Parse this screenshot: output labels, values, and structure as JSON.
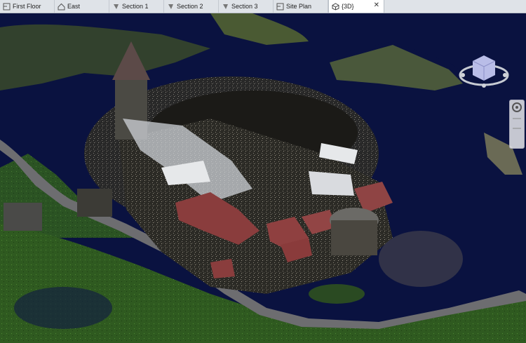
{
  "tabs": [
    {
      "label": "First Floor",
      "icon": "floor-plan-icon",
      "active": false
    },
    {
      "label": "East",
      "icon": "elevation-icon",
      "active": false
    },
    {
      "label": "Section 1",
      "icon": "section-icon",
      "active": false
    },
    {
      "label": "Section 2",
      "icon": "section-icon",
      "active": false
    },
    {
      "label": "Section 3",
      "icon": "section-icon",
      "active": false
    },
    {
      "label": "Site Plan",
      "icon": "floor-plan-icon",
      "active": false
    },
    {
      "label": "{3D}",
      "icon": "3d-view-icon",
      "active": true,
      "close": "✕"
    }
  ],
  "viewcube": {
    "icon": "viewcube-icon"
  },
  "navigation_bar": {
    "icon": "steering-wheel-icon"
  },
  "scene": {
    "description_icon": "point-cloud-castle-model",
    "background_color": "#0a1240"
  }
}
